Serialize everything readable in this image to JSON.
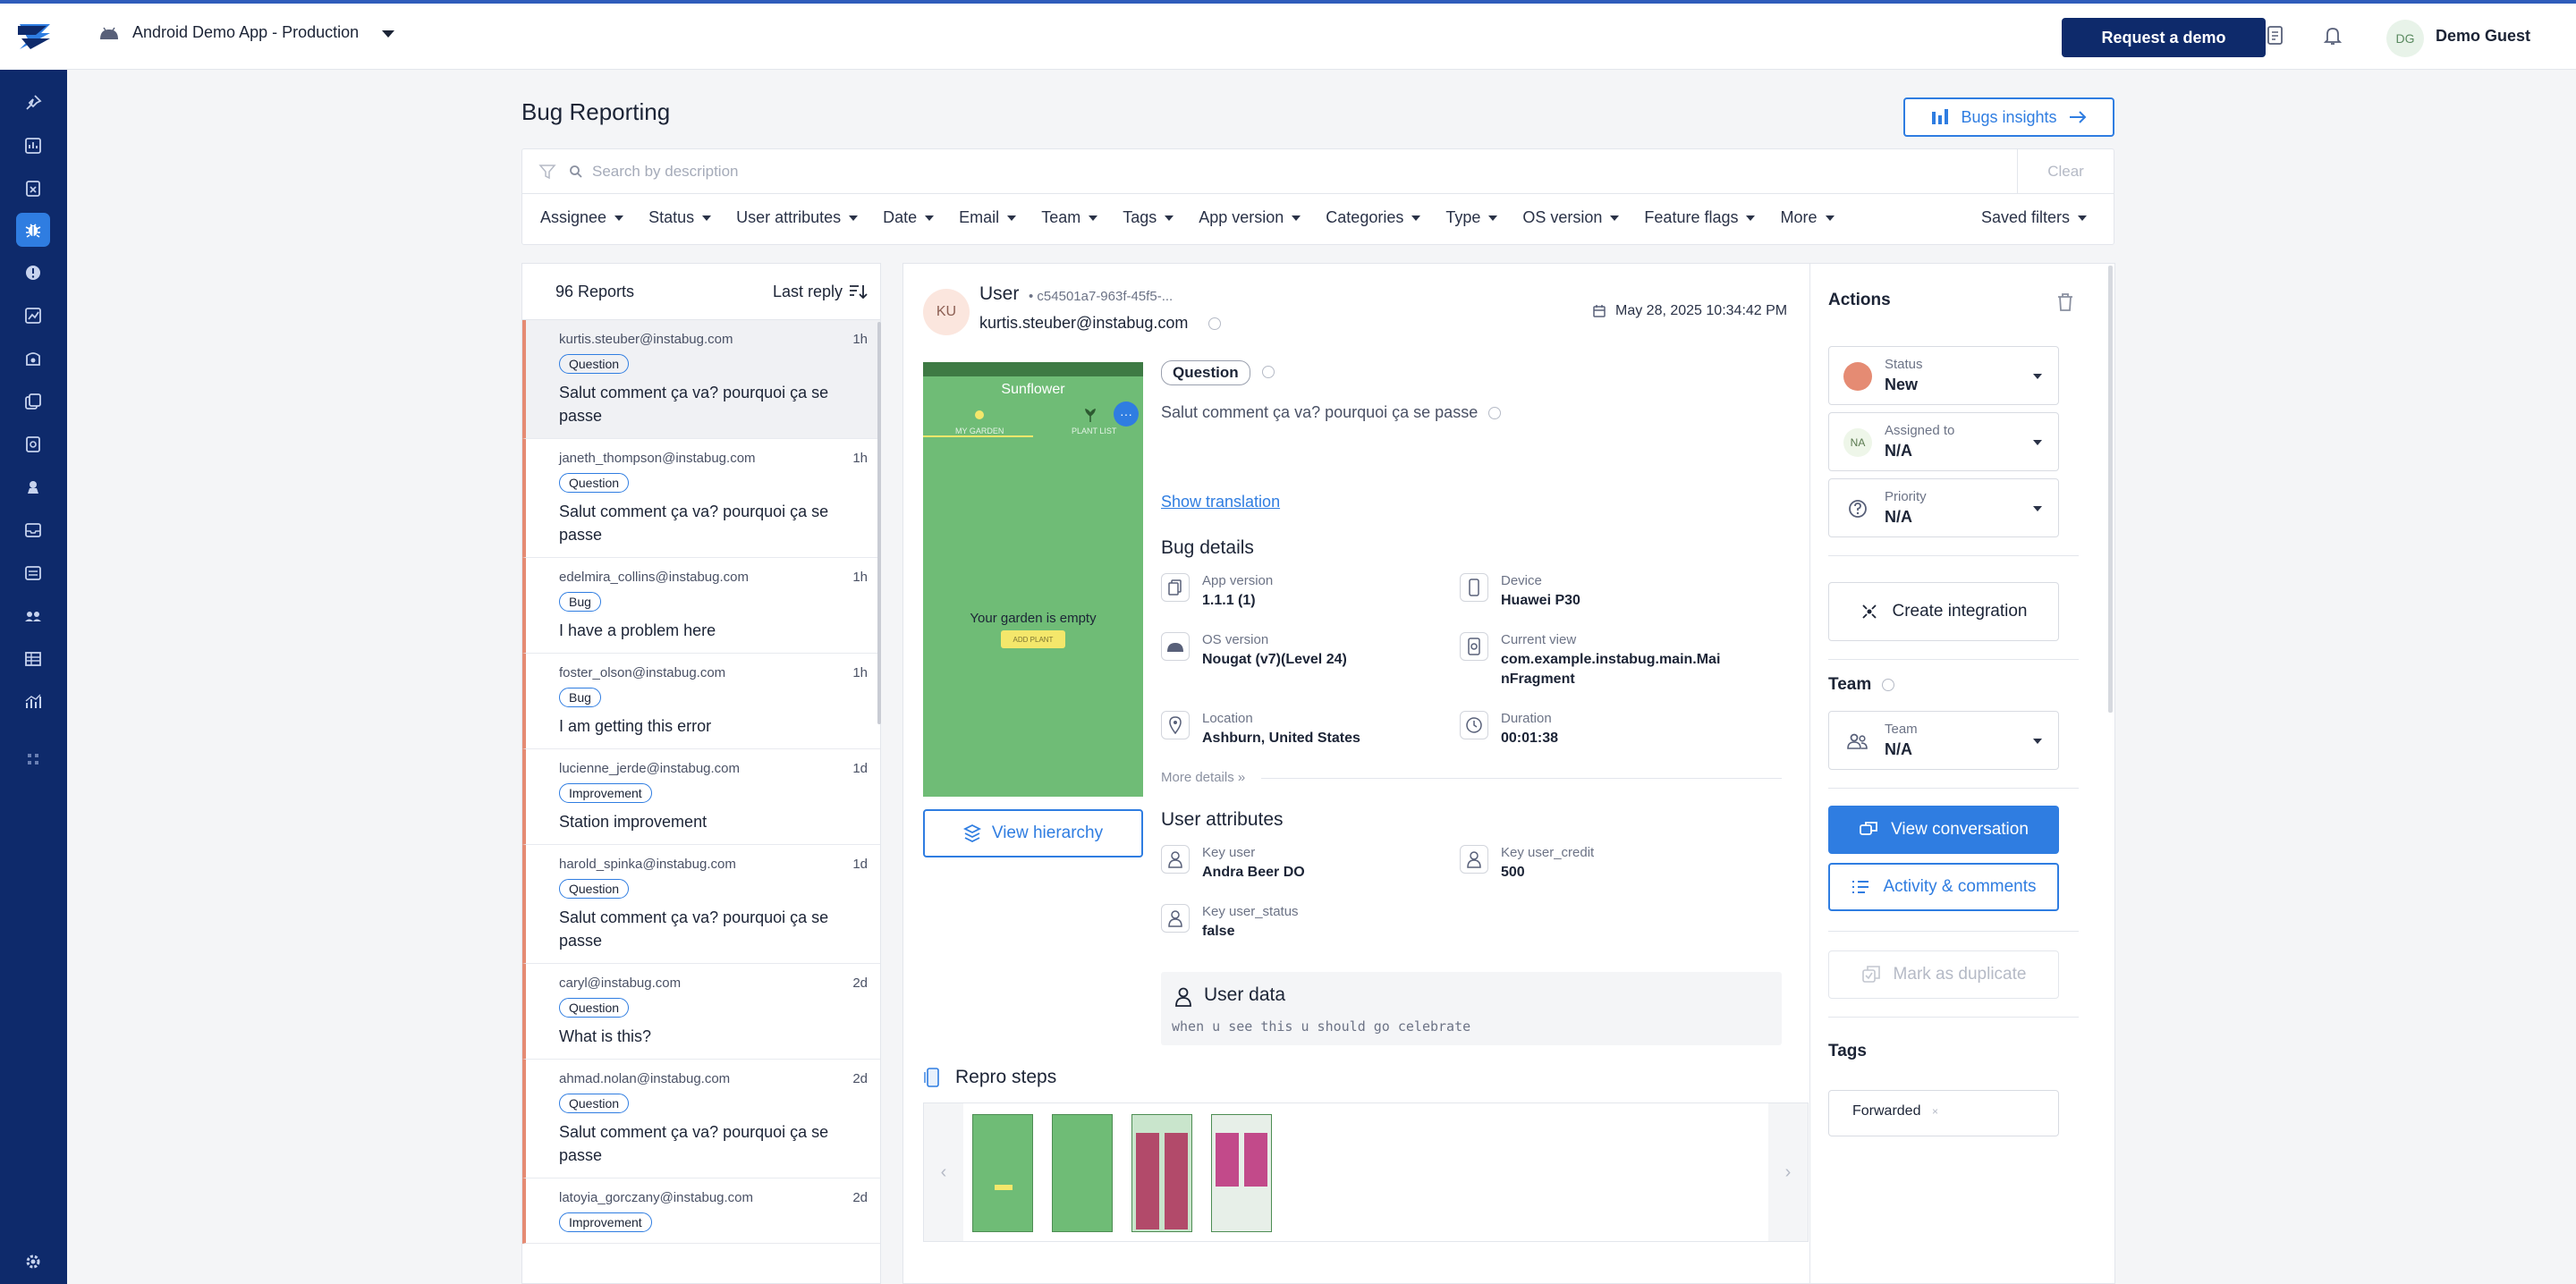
{
  "header": {
    "app_name": "Android Demo App - Production",
    "request_demo": "Request a demo",
    "user_initials": "DG",
    "user_name": "Demo Guest"
  },
  "sidebar": {
    "icons": [
      "pin-icon",
      "dashboard-icon",
      "crash-icon",
      "bug-icon",
      "alert-icon",
      "apm-icon",
      "session-icon",
      "release-icon",
      "survey-icon",
      "feature-request-icon",
      "inbox-icon",
      "settings-list-icon",
      "team-icon",
      "table-icon",
      "analytics-icon",
      "apps-icon"
    ],
    "settings_icon": "gear-icon"
  },
  "page": {
    "title": "Bug Reporting",
    "insights_button": "Bugs insights"
  },
  "search": {
    "placeholder": "Search by description",
    "clear": "Clear"
  },
  "filters": [
    "Assignee",
    "Status",
    "User attributes",
    "Date",
    "Email",
    "Team",
    "Tags",
    "App version",
    "Categories",
    "Type",
    "OS version",
    "Feature flags",
    "More"
  ],
  "saved_filters": "Saved filters",
  "list": {
    "count": "96 Reports",
    "sort": "Last reply",
    "reports": [
      {
        "email": "kurtis.steuber@instabug.com",
        "time": "1h",
        "category": "Question",
        "message": "Salut comment ça va? pourquoi ça se passe"
      },
      {
        "email": "janeth_thompson@instabug.com",
        "time": "1h",
        "category": "Question",
        "message": "Salut comment ça va? pourquoi ça se passe"
      },
      {
        "email": "edelmira_collins@instabug.com",
        "time": "1h",
        "category": "Bug",
        "message": "I have a problem here"
      },
      {
        "email": "foster_olson@instabug.com",
        "time": "1h",
        "category": "Bug",
        "message": "I am getting this error"
      },
      {
        "email": "lucienne_jerde@instabug.com",
        "time": "1d",
        "category": "Improvement",
        "message": "Station improvement"
      },
      {
        "email": "harold_spinka@instabug.com",
        "time": "1d",
        "category": "Question",
        "message": "Salut comment ça va? pourquoi ça se passe"
      },
      {
        "email": "caryl@instabug.com",
        "time": "2d",
        "category": "Question",
        "message": "What is this?"
      },
      {
        "email": "ahmad.nolan@instabug.com",
        "time": "2d",
        "category": "Question",
        "message": "Salut comment ça va? pourquoi ça se passe"
      },
      {
        "email": "latoyia_gorczany@instabug.com",
        "time": "2d",
        "category": "Improvement",
        "message": ""
      }
    ]
  },
  "detail": {
    "initials": "KU",
    "user_label": "User",
    "user_id": "• c54501a7-963f-45f5-...",
    "email": "kurtis.steuber@instabug.com",
    "date": "May 28, 2025 10:34:42 PM",
    "category": "Question",
    "description": "Salut comment ça va? pourquoi ça se passe",
    "show_translation": "Show translation",
    "screenshot": {
      "app_title": "Sunflower",
      "tab1": "MY GARDEN",
      "tab2": "PLANT LIST",
      "empty": "Your garden is empty",
      "add_plant": "ADD PLANT"
    },
    "view_hierarchy": "View hierarchy",
    "bug_details_title": "Bug details",
    "bug_details": [
      {
        "key": "App version",
        "value": "1.1.1 (1)",
        "icon": "app-version-icon"
      },
      {
        "key": "Device",
        "value": "Huawei P30",
        "icon": "device-icon"
      },
      {
        "key": "OS version",
        "value": "Nougat (v7)(Level 24)",
        "icon": "android-icon"
      },
      {
        "key": "Current view",
        "value": "com.example.instabug.main.MainFragment",
        "icon": "current-view-icon"
      },
      {
        "key": "Location",
        "value": "Ashburn, United States",
        "icon": "location-icon"
      },
      {
        "key": "Duration",
        "value": "00:01:38",
        "icon": "clock-icon"
      }
    ],
    "more_details": "More details »",
    "user_attributes_title": "User attributes",
    "user_attributes": [
      {
        "key": "Key user",
        "value": "Andra Beer DO"
      },
      {
        "key": "Key user_credit",
        "value": "500"
      },
      {
        "key": "Key user_status",
        "value": "false"
      }
    ],
    "user_data_title": "User data",
    "user_data": "when u see this u should go celebrate",
    "repro_title": "Repro steps"
  },
  "actions": {
    "title": "Actions",
    "status_label": "Status",
    "status_value": "New",
    "status_color": "#e58b73",
    "assigned_label": "Assigned to",
    "assigned_value": "N/A",
    "assigned_initials": "NA",
    "priority_label": "Priority",
    "priority_value": "N/A",
    "create_integration": "Create integration",
    "team_title": "Team",
    "team_label": "Team",
    "team_value": "N/A",
    "view_conversation": "View conversation",
    "activity": "Activity & comments",
    "mark_duplicate": "Mark as duplicate",
    "tags_title": "Tags",
    "tag": "Forwarded"
  }
}
